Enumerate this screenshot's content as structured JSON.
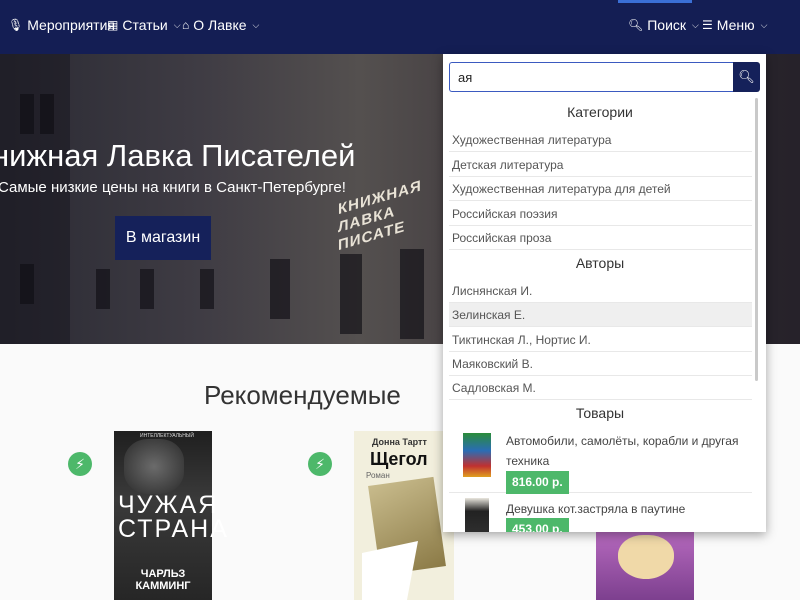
{
  "nav": {
    "events": "Мероприятия",
    "articles": "Статьи",
    "about": "О Лавке",
    "search": "Поиск",
    "menu": "Меню"
  },
  "hero": {
    "title": "нижная Лавка Писателей",
    "subtitle": "Самые низкие цены на книги в Санкт-Петербурге!",
    "button": "В магазин",
    "sign_text": "КНИЖНАЯ ЛАВКА ПИСАТЕ"
  },
  "recommended": {
    "title": "Рекомендуемые",
    "books": [
      {
        "title": "ЧУЖАЯ СТРАНА",
        "author": "ЧАРЛЬЗ КАММИНГ",
        "top": "ИНТЕЛЛЕКТУАЛЬНЫЙ"
      },
      {
        "title": "Щегол",
        "author": "Донна Тартт",
        "subtitle": "Роман"
      },
      {
        "title": ""
      }
    ]
  },
  "search": {
    "value": "ая",
    "categories_heading": "Категории",
    "categories": [
      "Художественная литература",
      "Детская литература",
      "Художественная литература для детей",
      "Российская поэзия",
      "Российская проза"
    ],
    "authors_heading": "Авторы",
    "authors": [
      "Лиснянская И.",
      "Зелинская Е.",
      "Тиктинская Л., Нортис И.",
      "Маяковский В.",
      "Садловская М."
    ],
    "highlighted_author_index": 1,
    "products_heading": "Товары",
    "products": [
      {
        "name": "Автомобили, самолёты, корабли и другая техника",
        "price": "816.00 р."
      },
      {
        "name": "Девушка кот.застряла в паутине",
        "price": "453.00 р."
      }
    ]
  },
  "colors": {
    "navbar": "#141e54",
    "accent_green": "#4db86a",
    "button_dark": "#15215a"
  }
}
